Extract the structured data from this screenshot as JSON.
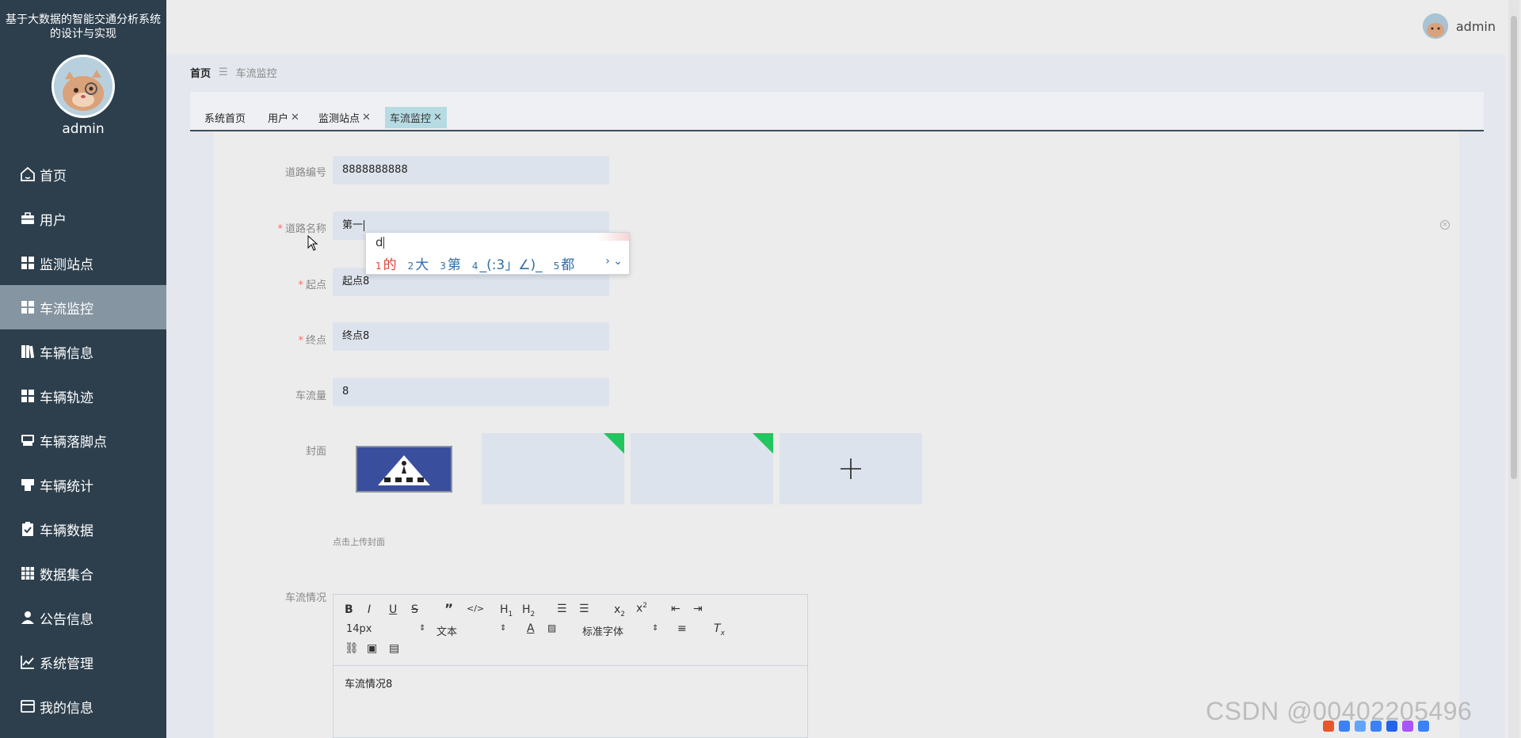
{
  "app": {
    "title": "基于大数据的智能交通分析系统的设计与实现",
    "user": "admin"
  },
  "menu": [
    {
      "label": "首页",
      "icon": "home-icon"
    },
    {
      "label": "用户",
      "icon": "briefcase-icon"
    },
    {
      "label": "监测站点",
      "icon": "grid-icon"
    },
    {
      "label": "车流监控",
      "icon": "grid-icon",
      "active": true
    },
    {
      "label": "车辆信息",
      "icon": "book-icon"
    },
    {
      "label": "车辆轨迹",
      "icon": "grid-icon"
    },
    {
      "label": "车辆落脚点",
      "icon": "inbox-icon"
    },
    {
      "label": "车辆统计",
      "icon": "printer-icon"
    },
    {
      "label": "车辆数据",
      "icon": "clipboard-check-icon"
    },
    {
      "label": "数据集合",
      "icon": "table-grid-icon"
    },
    {
      "label": "公告信息",
      "icon": "user-icon"
    },
    {
      "label": "系统管理",
      "icon": "chart-line-icon"
    },
    {
      "label": "我的信息",
      "icon": "id-card-icon"
    }
  ],
  "breadcrumb": {
    "home": "首页",
    "sep": "☰",
    "current": "车流监控"
  },
  "tabs": [
    {
      "label": "系统首页",
      "closable": false
    },
    {
      "label": "用户",
      "closable": true
    },
    {
      "label": "监测站点",
      "closable": true
    },
    {
      "label": "车流监控",
      "closable": true,
      "active": true
    }
  ],
  "form": {
    "road_no": {
      "label": "道路编号",
      "value": "8888888888"
    },
    "road_name": {
      "label": "道路名称",
      "value": "第一",
      "required": true
    },
    "start": {
      "label": "起点",
      "value": "起点8",
      "required": true
    },
    "end": {
      "label": "终点",
      "value": "终点8",
      "required": true
    },
    "flow": {
      "label": "车流量",
      "value": "8"
    },
    "cover": {
      "label": "封面",
      "tip": "点击上传封面"
    },
    "situation": {
      "label": "车流情况",
      "content": "车流情况8"
    }
  },
  "ime": {
    "input": "d",
    "candidates": [
      {
        "n": "1",
        "text": "的"
      },
      {
        "n": "2",
        "text": "大"
      },
      {
        "n": "3",
        "text": "第"
      },
      {
        "n": "4",
        "text": "_(:3」∠)_"
      },
      {
        "n": "5",
        "text": "都"
      }
    ],
    "nav": "› ⌄"
  },
  "editor": {
    "font_size": "14px",
    "block_type": "文本",
    "font_family": "标准字体"
  },
  "colors": {
    "sidebar": "#2d3f4d",
    "sidebar_active": "#8595a1",
    "tab_active": "#b6dbe3",
    "field_bg": "#dde3ec",
    "required": "#f56c6c",
    "upload_badge": "#22c55e"
  },
  "watermark": "CSDN @00402205496"
}
